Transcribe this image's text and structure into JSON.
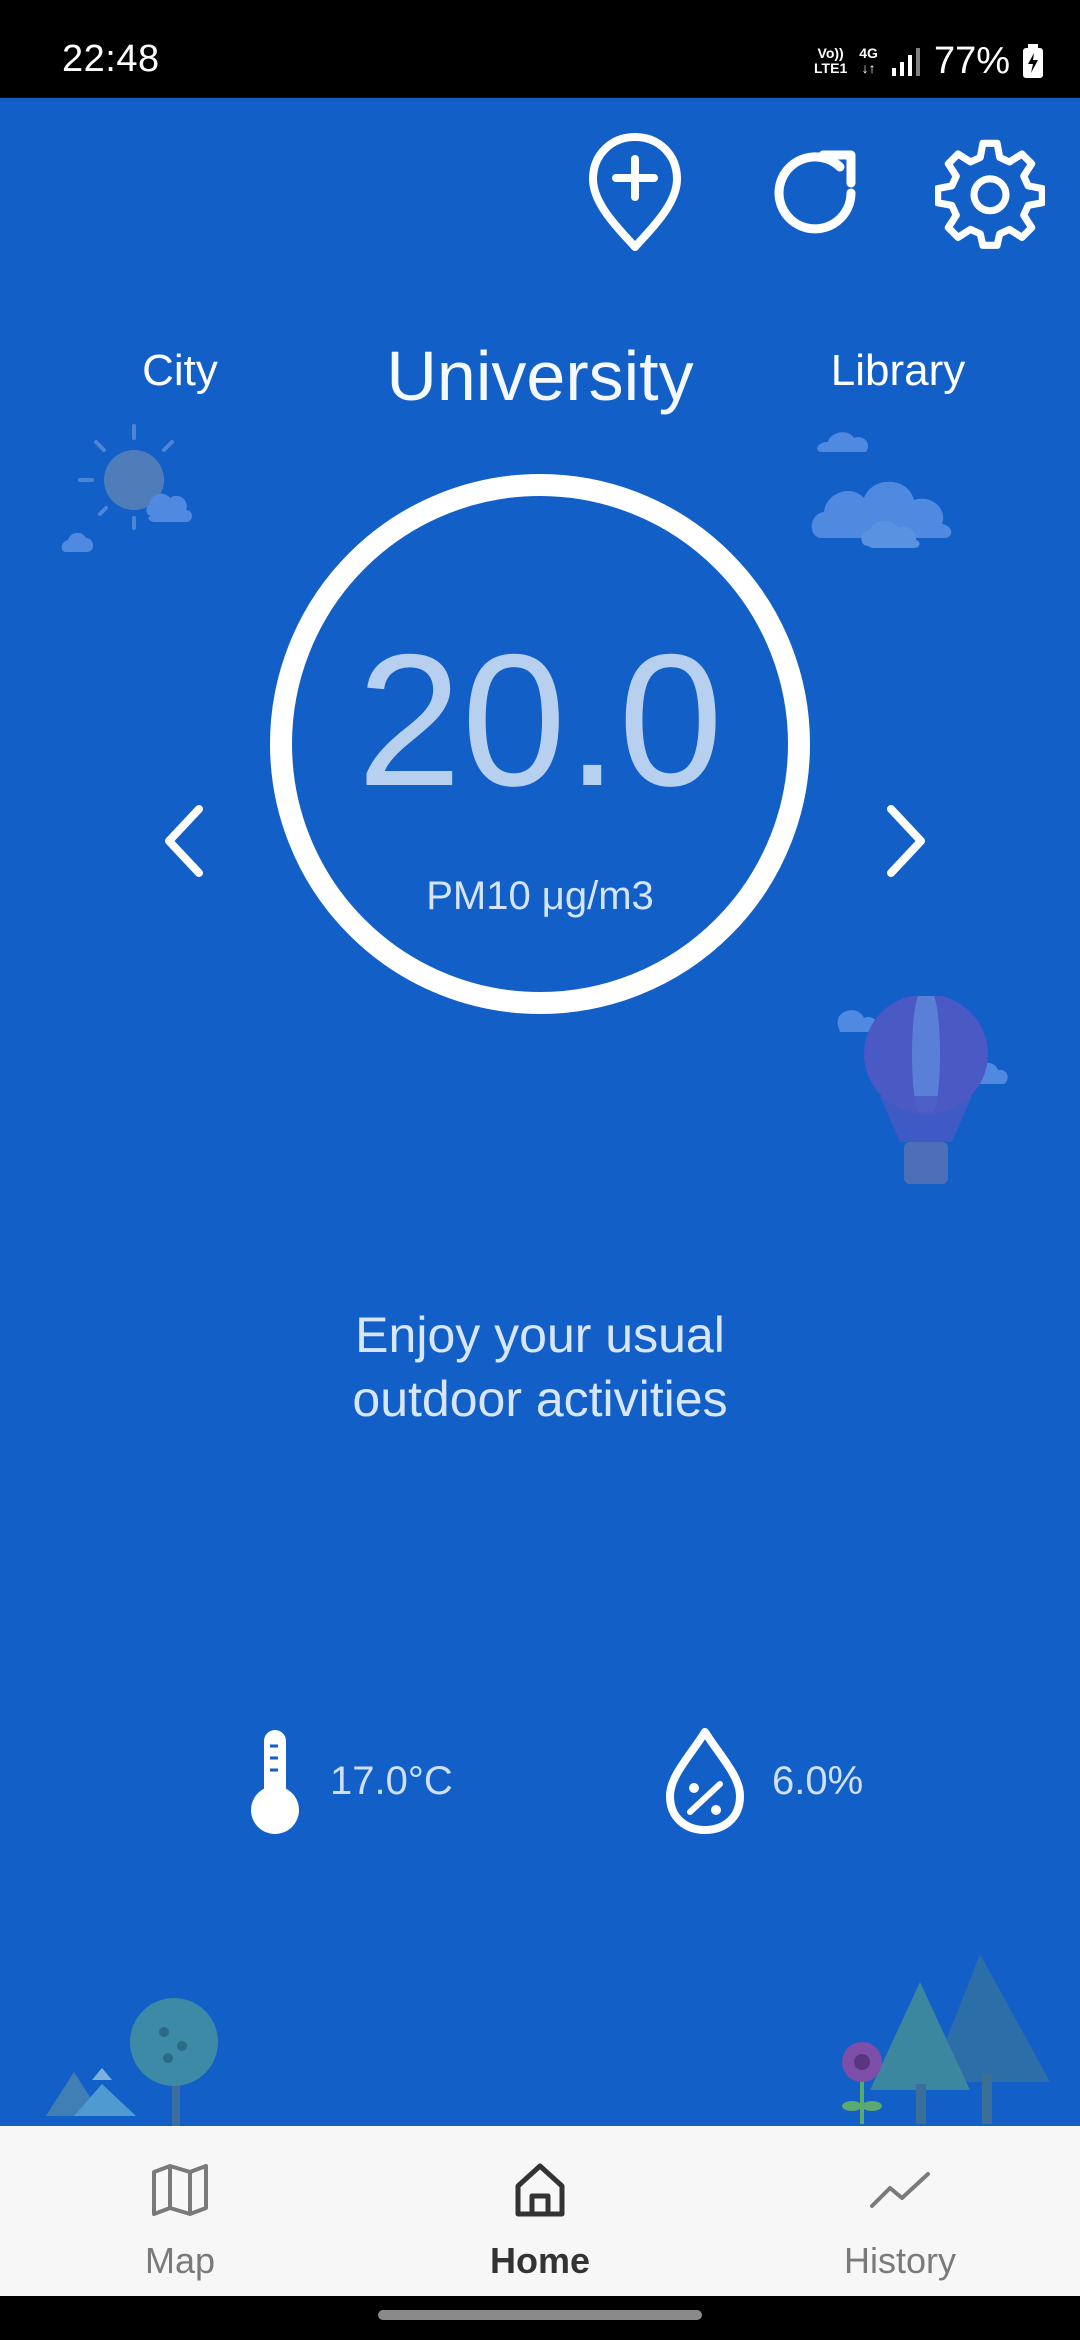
{
  "status_bar": {
    "time": "22:48",
    "volte_line1": "Vo))",
    "volte_line2": "LTE1",
    "network": "4G",
    "battery": "77%"
  },
  "header": {
    "add_location_icon": "add-location-pin",
    "refresh_icon": "refresh",
    "settings_icon": "gear"
  },
  "locations": {
    "previous": "City",
    "current": "University",
    "next": "Library"
  },
  "gauge": {
    "value": "20.0",
    "unit": "PM10 μg/m3"
  },
  "advice": {
    "line1": "Enjoy your usual",
    "line2": "outdoor activities"
  },
  "metrics": {
    "temperature": "17.0°C",
    "humidity": "6.0%"
  },
  "bottom_nav": {
    "items": [
      {
        "label": "Map",
        "icon": "map"
      },
      {
        "label": "Home",
        "icon": "home"
      },
      {
        "label": "History",
        "icon": "trend-line"
      }
    ],
    "active": "Home"
  },
  "colors": {
    "background": "#125fc8",
    "nav_background": "#f7f7f7",
    "gauge_ring": "#ffffff"
  }
}
